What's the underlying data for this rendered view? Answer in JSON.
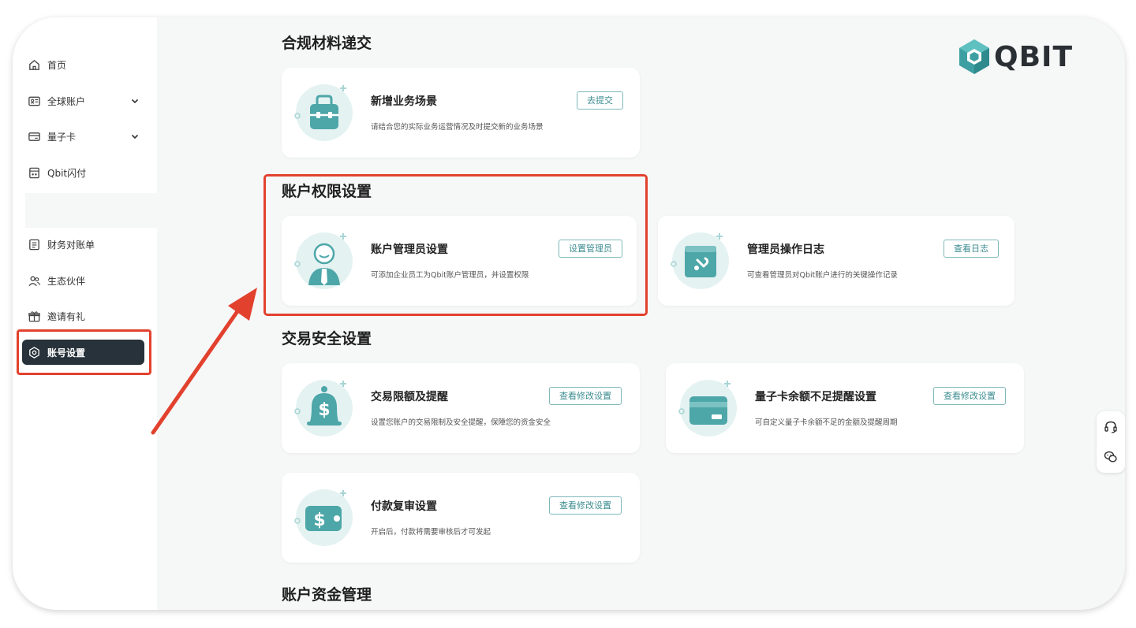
{
  "sidebar": {
    "items": [
      {
        "label": "首页",
        "icon": "home-icon"
      },
      {
        "label": "全球账户",
        "icon": "id-card-icon",
        "expandable": true
      },
      {
        "label": "量子卡",
        "icon": "card-icon",
        "expandable": true
      },
      {
        "label": "Qbit闪付",
        "icon": "pay-icon"
      },
      {
        "label": "财务对账单",
        "icon": "document-icon"
      },
      {
        "label": "生态伙伴",
        "icon": "partners-icon"
      },
      {
        "label": "邀请有礼",
        "icon": "gift-icon"
      },
      {
        "label": "账号设置",
        "icon": "settings-icon",
        "active": true
      }
    ]
  },
  "logo": {
    "text": "QBIT"
  },
  "sections": {
    "compliance": {
      "title": "合规材料递交"
    },
    "permissions": {
      "title": "账户权限设置"
    },
    "security": {
      "title": "交易安全设置"
    },
    "funds": {
      "title": "账户资金管理"
    }
  },
  "cards": {
    "new_scenario": {
      "title": "新增业务场景",
      "desc": "请结合您的实际业务运营情况及时提交新的业务场景",
      "button": "去提交"
    },
    "admin_settings": {
      "title": "账户管理员设置",
      "desc": "可添加企业员工为Qbit账户管理员，并设置权限",
      "button": "设置管理员"
    },
    "admin_log": {
      "title": "管理员操作日志",
      "desc": "可查看管理员对Qbit账户进行的关键操作记录",
      "button": "查看日志"
    },
    "tx_limit": {
      "title": "交易限额及提醒",
      "desc": "设置您账户的交易限制及安全提醒，保障您的资金安全",
      "button": "查看修改设置"
    },
    "card_balance": {
      "title": "量子卡余额不足提醒设置",
      "desc": "可自定义量子卡余额不足的金额及提醒周期",
      "button": "查看修改设置"
    },
    "payment_review": {
      "title": "付款复审设置",
      "desc": "开启后，付款将需要审核后才可发起",
      "button": "查看修改设置"
    }
  },
  "colors": {
    "accent": "#4a9fa3",
    "active_nav": "#27323a",
    "highlight": "#e2412e"
  }
}
